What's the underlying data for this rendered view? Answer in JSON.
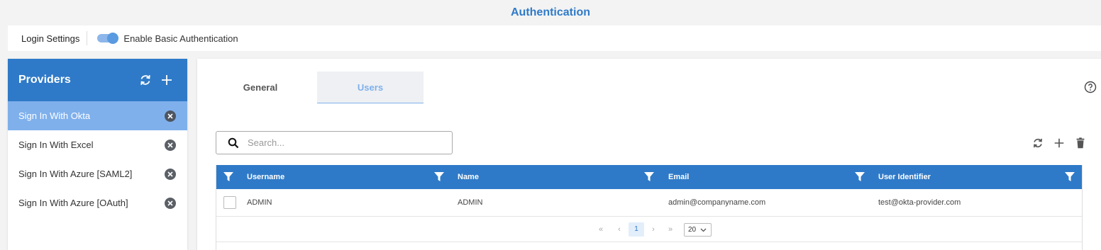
{
  "page_title": "Authentication",
  "settings": {
    "login_settings_label": "Login Settings",
    "basic_auth_label": "Enable Basic Authentication",
    "basic_auth_enabled": true
  },
  "providers": {
    "title": "Providers",
    "header_icons": [
      "refresh-icon",
      "plus-icon"
    ],
    "items": [
      {
        "label": "Sign In With Okta",
        "active": true
      },
      {
        "label": "Sign In With Excel",
        "active": false
      },
      {
        "label": "Sign In With Azure [SAML2]",
        "active": false
      },
      {
        "label": "Sign In With Azure [OAuth]",
        "active": false
      }
    ]
  },
  "tabs": [
    {
      "label": "General",
      "active": false
    },
    {
      "label": "Users",
      "active": true
    }
  ],
  "search": {
    "placeholder": "Search..."
  },
  "toolbar_icons": [
    "refresh-icon",
    "plus-icon",
    "trash-icon"
  ],
  "grid": {
    "columns": [
      "Username",
      "Name",
      "Email",
      "User Identifier"
    ],
    "rows": [
      {
        "username": "ADMIN",
        "name": "ADMIN",
        "email": "admin@companyname.com",
        "user_identifier": "test@okta-provider.com"
      }
    ]
  },
  "pagination": {
    "first": "«",
    "prev": "‹",
    "current_page": "1",
    "next": "›",
    "last": "»",
    "page_size": "20"
  },
  "colors": {
    "accent": "#2f7ac8",
    "active_item": "#7fb0ec",
    "tab_active_text": "#7fb0ec"
  }
}
